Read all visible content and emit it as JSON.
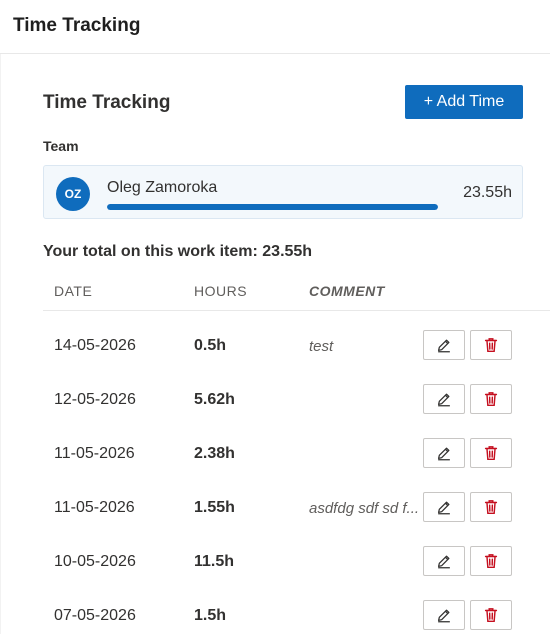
{
  "header": {
    "title": "Time Tracking"
  },
  "section": {
    "title": "Time Tracking",
    "add_button_label": "+ Add Time"
  },
  "team": {
    "label": "Team",
    "members": [
      {
        "initials": "OZ",
        "name": "Oleg Zamoroka",
        "hours": "23.55h",
        "share": 1.0
      }
    ]
  },
  "total_text": "Your total on this work item: 23.55h",
  "table": {
    "columns": {
      "date": "DATE",
      "hours": "HOURS",
      "comment": "COMMENT"
    },
    "rows": [
      {
        "date": "14-05-2026",
        "hours": "0.5h",
        "comment": "test"
      },
      {
        "date": "12-05-2026",
        "hours": "5.62h",
        "comment": ""
      },
      {
        "date": "11-05-2026",
        "hours": "2.38h",
        "comment": ""
      },
      {
        "date": "11-05-2026",
        "hours": "1.55h",
        "comment": "asdfdg sdf sd f..."
      },
      {
        "date": "10-05-2026",
        "hours": "11.5h",
        "comment": ""
      },
      {
        "date": "07-05-2026",
        "hours": "1.5h",
        "comment": ""
      }
    ]
  },
  "icons": {
    "edit": "pencil-icon",
    "delete": "trash-icon"
  },
  "colors": {
    "accent": "#0f6cbd",
    "danger": "#c50f1f",
    "card_bg": "#f3f8fc"
  }
}
